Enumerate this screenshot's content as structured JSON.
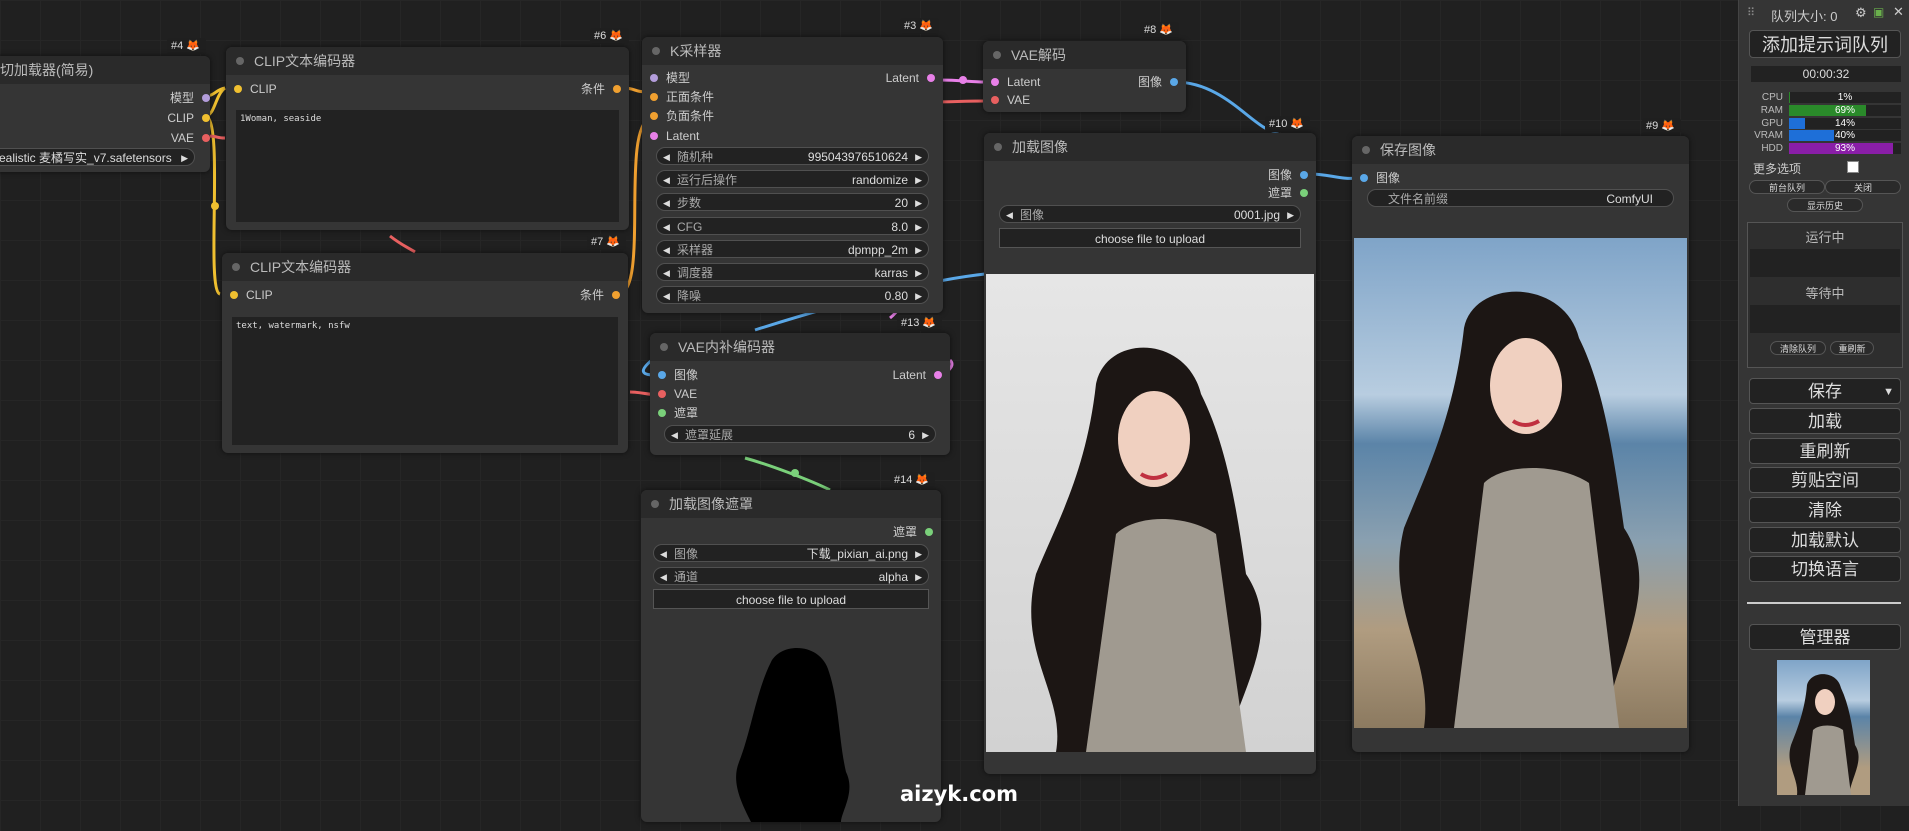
{
  "nodes": {
    "ckpt": {
      "badge": "#4",
      "title": "切加载器(简易)",
      "out": {
        "model": "模型",
        "clip": "CLIP",
        "vae": "VAE"
      },
      "ckpt_name": "ealistic 麦橘写实_v7.safetensors"
    },
    "clip1": {
      "badge": "#6",
      "title": "CLIP文本编码器",
      "in_clip": "CLIP",
      "out": "条件",
      "text": "1Woman, seaside"
    },
    "clip2": {
      "badge": "#7",
      "title": "CLIP文本编码器",
      "in_clip": "CLIP",
      "out": "条件",
      "text": "text, watermark, nsfw"
    },
    "ksampler": {
      "badge": "#3",
      "title": "K采样器",
      "in": {
        "model": "模型",
        "positive": "正面条件",
        "negative": "负面条件",
        "latent": "Latent"
      },
      "out": "Latent",
      "widgets": [
        {
          "label": "随机种",
          "value": "995043976510624"
        },
        {
          "label": "运行后操作",
          "value": "randomize"
        },
        {
          "label": "步数",
          "value": "20"
        },
        {
          "label": "CFG",
          "value": "8.0"
        },
        {
          "label": "采样器",
          "value": "dpmpp_2m"
        },
        {
          "label": "调度器",
          "value": "karras"
        },
        {
          "label": "降噪",
          "value": "0.80"
        }
      ]
    },
    "vaedecode": {
      "badge": "#8",
      "title": "VAE解码",
      "in": {
        "latent": "Latent",
        "vae": "VAE"
      },
      "out": "图像"
    },
    "loadimage": {
      "badge": "#10",
      "title": "加载图像",
      "out": {
        "image": "图像",
        "mask": "遮罩"
      },
      "widget": {
        "label": "图像",
        "value": "0001.jpg"
      },
      "upload": "choose file to upload"
    },
    "saveimage": {
      "badge": "#9",
      "title": "保存图像",
      "in": "图像",
      "widget": {
        "label": "文件名前缀",
        "value": "ComfyUI"
      }
    },
    "vaeinpaint": {
      "badge": "#13",
      "title": "VAE内补编码器",
      "in": {
        "image": "图像",
        "vae": "VAE",
        "mask": "遮罩"
      },
      "out": "Latent",
      "widget": {
        "label": "遮罩延展",
        "value": "6"
      }
    },
    "loadmask": {
      "badge": "#14",
      "title": "加载图像遮罩",
      "out": "遮罩",
      "widgets": [
        {
          "label": "图像",
          "value": "下载_pixian_ai.png"
        },
        {
          "label": "通道",
          "value": "alpha"
        }
      ],
      "upload": "choose file to upload"
    }
  },
  "panel": {
    "queue_size": "队列大小: 0",
    "queue_prompt": "添加提示词队列",
    "timer": "00:00:32",
    "stats": [
      {
        "name": "CPU",
        "pct": "1%",
        "value": 0.01,
        "color": "#2a8a2a"
      },
      {
        "name": "RAM",
        "pct": "69%",
        "value": 0.69,
        "color": "#2a8a2a"
      },
      {
        "name": "GPU",
        "pct": "14%",
        "value": 0.14,
        "color": "#1e6fd8"
      },
      {
        "name": "VRAM",
        "pct": "40%",
        "value": 0.4,
        "color": "#1e6fd8"
      },
      {
        "name": "HDD",
        "pct": "93%",
        "value": 0.93,
        "color": "#8a1ea8"
      }
    ],
    "more_options": "更多选项",
    "front_queue": "前台队列",
    "close": "关闭",
    "show_history": "显示历史",
    "running": "运行中",
    "pending": "等待中",
    "clear_queue": "清除队列",
    "refresh_small": "重刷新",
    "buttons": [
      "保存",
      "加载",
      "重刷新",
      "剪贴空间",
      "清除",
      "加载默认",
      "切换语言"
    ],
    "manager": "管理器"
  },
  "watermark": "aizyk.com"
}
